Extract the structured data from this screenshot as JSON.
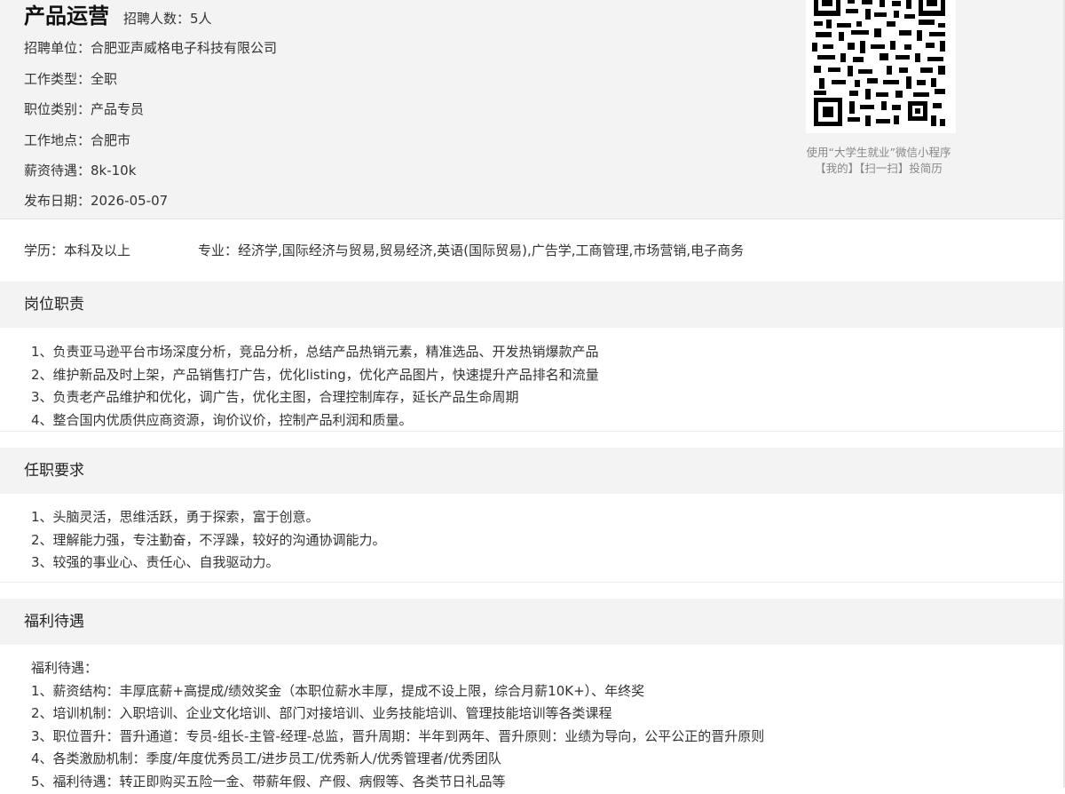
{
  "job": {
    "title": "产品运营",
    "headcount": "招聘人数：5人"
  },
  "details": [
    "招聘单位：合肥亚声威格电子科技有限公司",
    "工作类型：全职",
    "职位类别：产品专员",
    "工作地点：合肥市",
    "薪资待遇：8k-10k",
    "发布日期：2026-05-07"
  ],
  "qr": {
    "caption_line1": "使用“大学生就业”微信小程序",
    "caption_line2": "【我的】【扫一扫】投简历"
  },
  "requirements_row": {
    "education": "学历：本科及以上",
    "major": "专业：经济学,国际经济与贸易,贸易经济,英语(国际贸易),广告学,工商管理,市场营销,电子商务"
  },
  "responsibilities": {
    "heading": "岗位职责",
    "items": [
      "1、负责亚马逊平台市场深度分析，竞品分析，总结产品热销元素，精准选品、开发热销爆款产品",
      "2、维护新品及时上架，产品销售打广告，优化listing，优化产品图片，快速提升产品排名和流量",
      "3、负责老产品维护和优化，调广告，优化主图，合理控制库存，延长产品生命周期",
      "4、整合国内优质供应商资源，询价议价，控制产品利润和质量。"
    ]
  },
  "qualifications": {
    "heading": "任职要求",
    "items": [
      "1、头脑灵活，思维活跃，勇于探索，富于创意。",
      "2、理解能力强，专注勤奋，不浮躁，较好的沟通协调能力。",
      "3、较强的事业心、责任心、自我驱动力。"
    ]
  },
  "benefits": {
    "heading": "福利待遇",
    "items": [
      "福利待遇：",
      "1、薪资结构：丰厚底薪+高提成/绩效奖金（本职位薪水丰厚，提成不设上限，综合月薪10K+）、年终奖",
      "2、培训机制：入职培训、企业文化培训、部门对接培训、业务技能培训、管理技能培训等各类课程",
      "3、职位晋升：晋升通道：专员-组长-主管-经理-总监，晋升周期：半年到两年、晋升原则：业绩为导向，公平公正的晋升原则",
      "4、各类激励机制：季度/年度优秀员工/进步员工/优秀新人/优秀管理者/优秀团队",
      "5、福利待遇：转正即购买五险一金、带薪年假、产假、病假等、各类节日礼品等"
    ]
  }
}
